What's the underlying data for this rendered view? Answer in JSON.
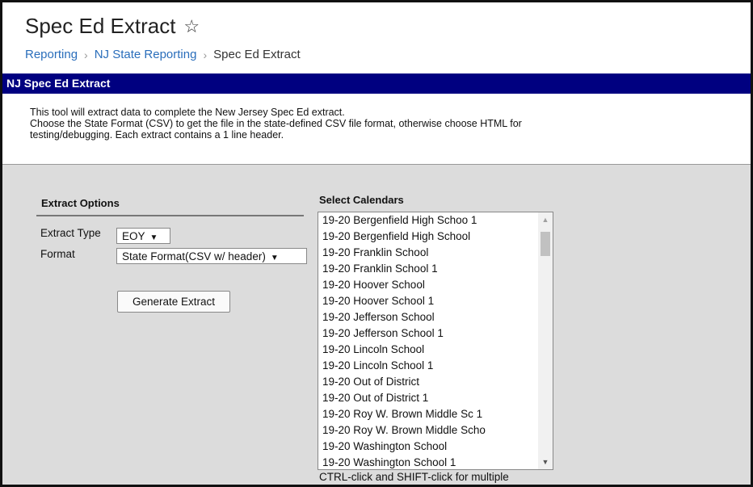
{
  "header": {
    "title": "Spec Ed Extract",
    "star_icon": "☆",
    "breadcrumb": [
      {
        "label": "Reporting"
      },
      {
        "label": "NJ State Reporting"
      },
      {
        "label": "Spec Ed Extract"
      }
    ],
    "separator": "›"
  },
  "panel": {
    "title": "NJ Spec Ed Extract",
    "description": [
      "This tool will extract data to complete the New Jersey Spec Ed extract.",
      "Choose the State Format (CSV) to get the file in the state-defined CSV file format, otherwise choose HTML for",
      "testing/debugging. Each extract contains a 1 line header."
    ]
  },
  "options": {
    "heading": "Extract Options",
    "extract_type_label": "Extract Type",
    "extract_type_value": "EOY",
    "format_label": "Format",
    "format_value": "State Format(CSV w/ header)",
    "generate_label": "Generate Extract"
  },
  "calendars": {
    "heading": "Select Calendars",
    "items": [
      "19-20 Bergenfield High Schoo 1",
      "19-20 Bergenfield High School",
      "19-20 Franklin School",
      "19-20 Franklin School 1",
      "19-20 Hoover School",
      "19-20 Hoover School 1",
      "19-20 Jefferson School",
      "19-20 Jefferson School 1",
      "19-20 Lincoln School",
      "19-20 Lincoln School 1",
      "19-20 Out of District",
      "19-20 Out of District 1",
      "19-20 Roy W. Brown Middle Sc 1",
      "19-20 Roy W. Brown Middle Scho",
      "19-20 Washington School",
      "19-20 Washington School 1"
    ],
    "hint": "CTRL-click and SHIFT-click for multiple"
  },
  "colors": {
    "titlebar_bg": "#000080",
    "link": "#2a6ebb",
    "form_bg": "#dcdcdc"
  }
}
